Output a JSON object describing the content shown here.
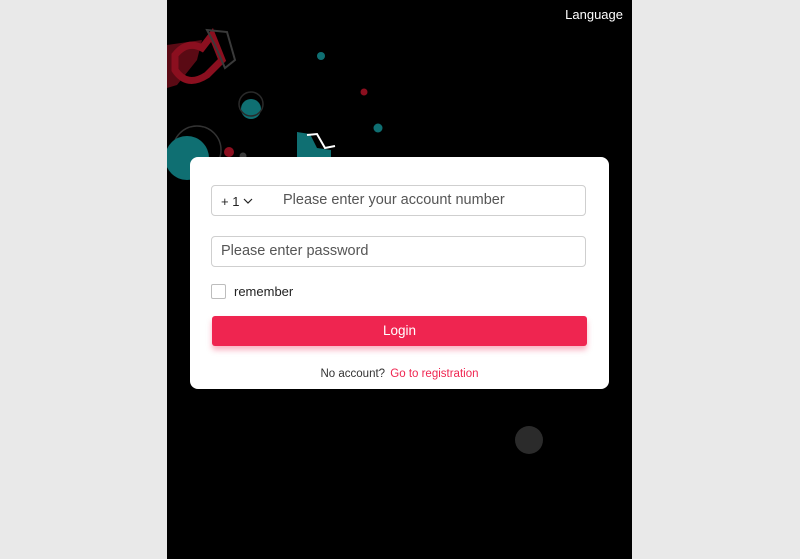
{
  "header": {
    "language_label": "Language"
  },
  "login_form": {
    "country_code": "+ 1",
    "account_placeholder": "Please enter your account number",
    "password_placeholder": "Please enter password",
    "remember_label": "remember",
    "login_button": "Login",
    "no_account_text": "No account?",
    "register_link": "Go to registration"
  },
  "colors": {
    "accent": "#ef2550",
    "background": "#000000",
    "teal_decor": "#0f6f72",
    "red_decor": "#8b0f1f"
  },
  "icons": [
    "chevron-down-icon",
    "tiktok-logo-decor"
  ]
}
